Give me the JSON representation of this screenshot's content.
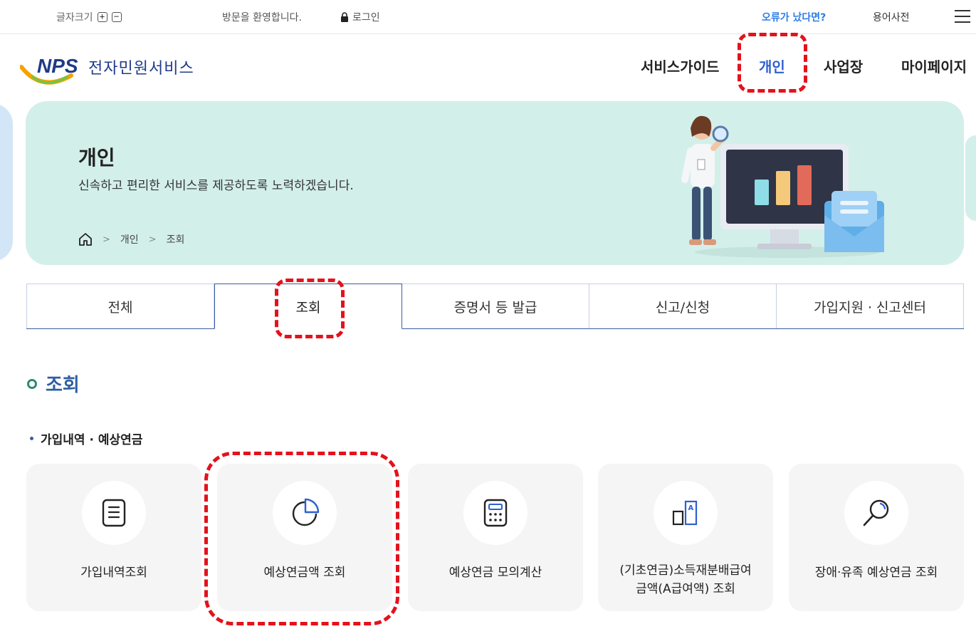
{
  "topbar": {
    "font_size_label": "글자크기",
    "welcome": "방문을 환영합니다.",
    "login": "로그인",
    "error_link": "오류가 났다면?",
    "glossary": "용어사전"
  },
  "header": {
    "logo_mark": "NPS",
    "logo_text": "전자민원서비스",
    "nav": [
      "서비스가이드",
      "개인",
      "사업장",
      "마이페이지"
    ],
    "active_nav": "개인"
  },
  "banner": {
    "title": "개인",
    "description": "신속하고 편리한 서비스를 제공하도록 노력하겠습니다.",
    "breadcrumb": [
      "개인",
      "조회"
    ]
  },
  "tabs": {
    "items": [
      "전체",
      "조회",
      "증명서 등 발급",
      "신고/신청",
      "가입지원 · 신고센터"
    ],
    "active": "조회"
  },
  "section": {
    "title": "조회",
    "subtitle": "가입내역 · 예상연금"
  },
  "cards": [
    {
      "label": "가입내역조회",
      "icon": "document-icon"
    },
    {
      "label": "예상연금액 조회",
      "icon": "pie-chart-icon"
    },
    {
      "label": "예상연금 모의계산",
      "icon": "calculator-icon"
    },
    {
      "label_line1": "(기초연금)소득재분배급여",
      "label_line2": "금액(A급여액) 조회",
      "icon": "bar-compare-icon"
    },
    {
      "label": "장애·유족 예상연금 조회",
      "icon": "magnifier-icon"
    }
  ],
  "colors": {
    "accent": "#2f5fd0",
    "banner_bg": "#d3efea",
    "highlight": "#e3121c"
  }
}
